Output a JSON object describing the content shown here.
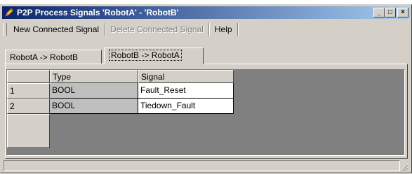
{
  "window": {
    "title": "P2P Process Signals 'RobotA' - 'RobotB'",
    "minimize": "_",
    "maximize": "□",
    "close": "×"
  },
  "toolbar": {
    "new_label": "New Connected Signal",
    "delete_label": "Delete Connected Signal",
    "help_label": "Help"
  },
  "tabs": [
    {
      "label": "RobotA -> RobotB",
      "active": false
    },
    {
      "label": "RobotB -> RobotA",
      "active": true
    }
  ],
  "table": {
    "columns": [
      "Type",
      "Signal"
    ],
    "rows": [
      {
        "num": "1",
        "type": "BOOL",
        "signal": "Fault_Reset"
      },
      {
        "num": "2",
        "type": "BOOL",
        "signal": "Tiedown_Fault"
      }
    ]
  },
  "colors": {
    "titlebar_start": "#0a246a",
    "titlebar_end": "#a6caf0",
    "face": "#d4d0c8"
  },
  "icons": {
    "app": "pencil-icon",
    "resize": "resize-grip-icon"
  }
}
